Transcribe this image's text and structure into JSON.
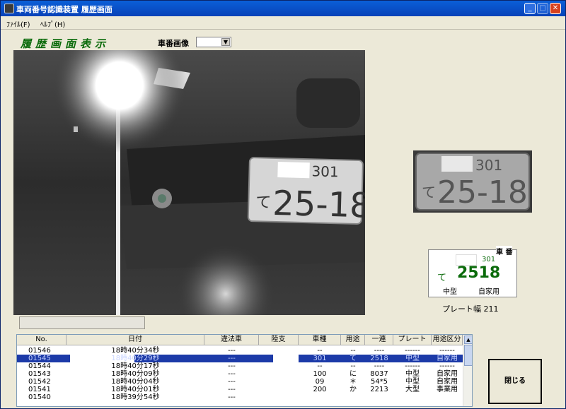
{
  "window": {
    "title": "車両番号認識装置 履歴画面",
    "minimize": "_",
    "maximize": "□",
    "close": "✕"
  },
  "menu": [
    {
      "label": "ﾌｧｲﾙ(F)"
    },
    {
      "label": "ﾍﾙﾌﾟ(H)"
    }
  ],
  "header": {
    "title": "履歴画面表示",
    "select_label": "車番画像",
    "select_value": ""
  },
  "camera_plate": {
    "class_number": "301",
    "kana": "て",
    "number": "25-18"
  },
  "crop_plate": {
    "class_number": "301",
    "kana": "て",
    "number": "25-18"
  },
  "result": {
    "heading": "車 番",
    "class_number": "301",
    "kana": "て",
    "number": "2518",
    "size": "中型",
    "use": "自家用"
  },
  "plate_width": {
    "label": "プレート幅",
    "value": "211"
  },
  "close_button": {
    "label": "閉じる"
  },
  "table": {
    "columns": [
      "No.",
      "日付",
      "違法車",
      "陸支",
      "車種",
      "用途",
      "一連",
      "プレート",
      "用途区分"
    ],
    "rows": [
      [
        "01546",
        "18時40分34秒",
        "---",
        "",
        "--",
        "--",
        "----",
        "------",
        "------"
      ],
      [
        "01545",
        "18時40分29秒",
        "---",
        "",
        "301",
        "て",
        "2518",
        "中型",
        "自家用"
      ],
      [
        "01544",
        "18時40分17秒",
        "---",
        "",
        "--",
        "--",
        "----",
        "------",
        "------"
      ],
      [
        "01543",
        "18時40分09秒",
        "---",
        "",
        "100",
        "に",
        "8037",
        "中型",
        "自家用"
      ],
      [
        "01542",
        "18時40分04秒",
        "---",
        "",
        "09",
        "＊",
        "54*5",
        "中型",
        "自家用"
      ],
      [
        "01541",
        "18時40分01秒",
        "---",
        "",
        "200",
        "か",
        "2213",
        "大型",
        "事業用"
      ],
      [
        "01540",
        "18時39分54秒",
        "---",
        "",
        "",
        "",
        "",
        "",
        ""
      ]
    ],
    "selected_index": 1
  },
  "colors": {
    "title_green": "#0b6b0b",
    "selection": "#1c3aa8"
  }
}
